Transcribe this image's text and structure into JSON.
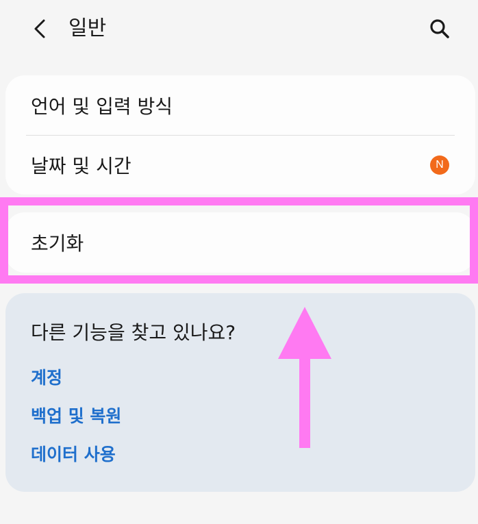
{
  "header": {
    "title": "일반",
    "back_icon": "chevron-left-icon",
    "search_icon": "search-icon"
  },
  "settings": {
    "items": [
      {
        "label": "언어 및 입력 방식"
      },
      {
        "label": "날짜 및 시간",
        "badge": "N"
      }
    ],
    "reset_label": "초기화"
  },
  "suggestions": {
    "title": "다른 기능을 찾고 있나요?",
    "links": [
      "계정",
      "백업 및 복원",
      "데이터 사용"
    ]
  },
  "colors": {
    "background": "#f5f5f5",
    "card": "#fdfdfd",
    "suggest_card": "#e3e9f0",
    "link": "#1f6fcc",
    "badge": "#f26a1b",
    "highlight": "#ff7af2"
  }
}
